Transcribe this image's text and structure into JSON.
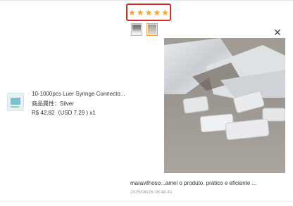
{
  "rating": {
    "value": 5,
    "max": 5,
    "highlight_color": "#d82a22",
    "star_color": "#f5a623"
  },
  "thumbnails": [
    {
      "icon": "photo-thumbnail"
    },
    {
      "icon": "photo-thumbnail",
      "selected": true
    }
  ],
  "viewer": {
    "close_label": "✕"
  },
  "product": {
    "title": "10-1000pcs Luer Syringe Connecto...",
    "attribute": "商品属性：Silver",
    "price": "R$ 42,82（USD  7.29 ) x1"
  },
  "review": {
    "text": "maravilhoso...amei o produto. prático e eficiente ...",
    "date": "2025/08/26 08:48:41"
  }
}
